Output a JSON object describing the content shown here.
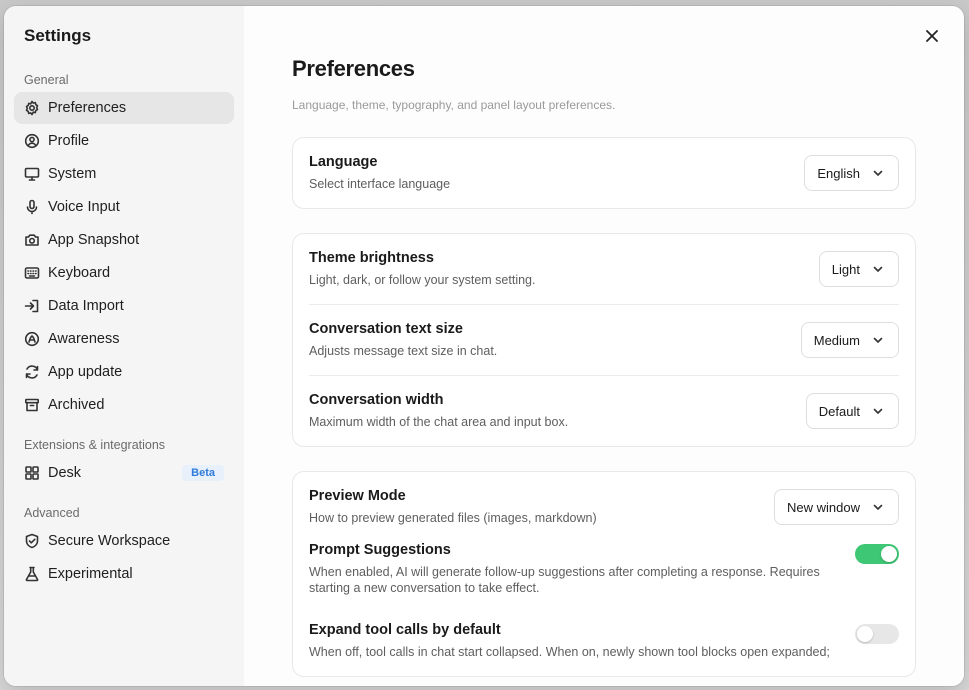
{
  "sidebar": {
    "title": "Settings",
    "sections": [
      {
        "label": "General",
        "items": [
          {
            "label": "Preferences",
            "icon": "gear-icon",
            "active": true
          },
          {
            "label": "Profile",
            "icon": "user-circle-icon"
          },
          {
            "label": "System",
            "icon": "monitor-icon"
          },
          {
            "label": "Voice Input",
            "icon": "microphone-icon"
          },
          {
            "label": "App Snapshot",
            "icon": "camera-icon"
          },
          {
            "label": "Keyboard",
            "icon": "keyboard-icon"
          },
          {
            "label": "Data Import",
            "icon": "import-icon"
          },
          {
            "label": "Awareness",
            "icon": "awareness-icon"
          },
          {
            "label": "App update",
            "icon": "refresh-icon"
          },
          {
            "label": "Archived",
            "icon": "archive-icon"
          }
        ]
      },
      {
        "label": "Extensions & integrations",
        "items": [
          {
            "label": "Desk",
            "icon": "grid-icon",
            "badge": "Beta"
          }
        ]
      },
      {
        "label": "Advanced",
        "items": [
          {
            "label": "Secure Workspace",
            "icon": "shield-icon"
          },
          {
            "label": "Experimental",
            "icon": "flask-icon"
          }
        ]
      }
    ]
  },
  "main": {
    "title": "Preferences",
    "subtitle": "Language, theme, typography, and panel layout preferences.",
    "language": {
      "title": "Language",
      "desc": "Select interface language",
      "value": "English"
    },
    "theme": {
      "title": "Theme brightness",
      "desc": "Light, dark, or follow your system setting.",
      "value": "Light"
    },
    "text_size": {
      "title": "Conversation text size",
      "desc": "Adjusts message text size in chat.",
      "value": "Medium"
    },
    "width": {
      "title": "Conversation width",
      "desc": "Maximum width of the chat area and input box.",
      "value": "Default"
    },
    "preview": {
      "title": "Preview Mode",
      "desc": "How to preview generated files (images, markdown)",
      "value": "New window"
    },
    "prompt_suggestions": {
      "title": "Prompt Suggestions",
      "desc": "When enabled, AI will generate follow-up suggestions after completing a response. Requires starting a new conversation to take effect.",
      "enabled": true
    },
    "expand_tools": {
      "title": "Expand tool calls by default",
      "desc": "When off, tool calls in chat start collapsed. When on, newly shown tool blocks open expanded;",
      "enabled": false
    }
  },
  "colors": {
    "toggle_on": "#3ec774",
    "badge_text": "#2f7bd8",
    "badge_bg": "#e7f0fb",
    "active_item_bg": "#e6e6e6"
  }
}
